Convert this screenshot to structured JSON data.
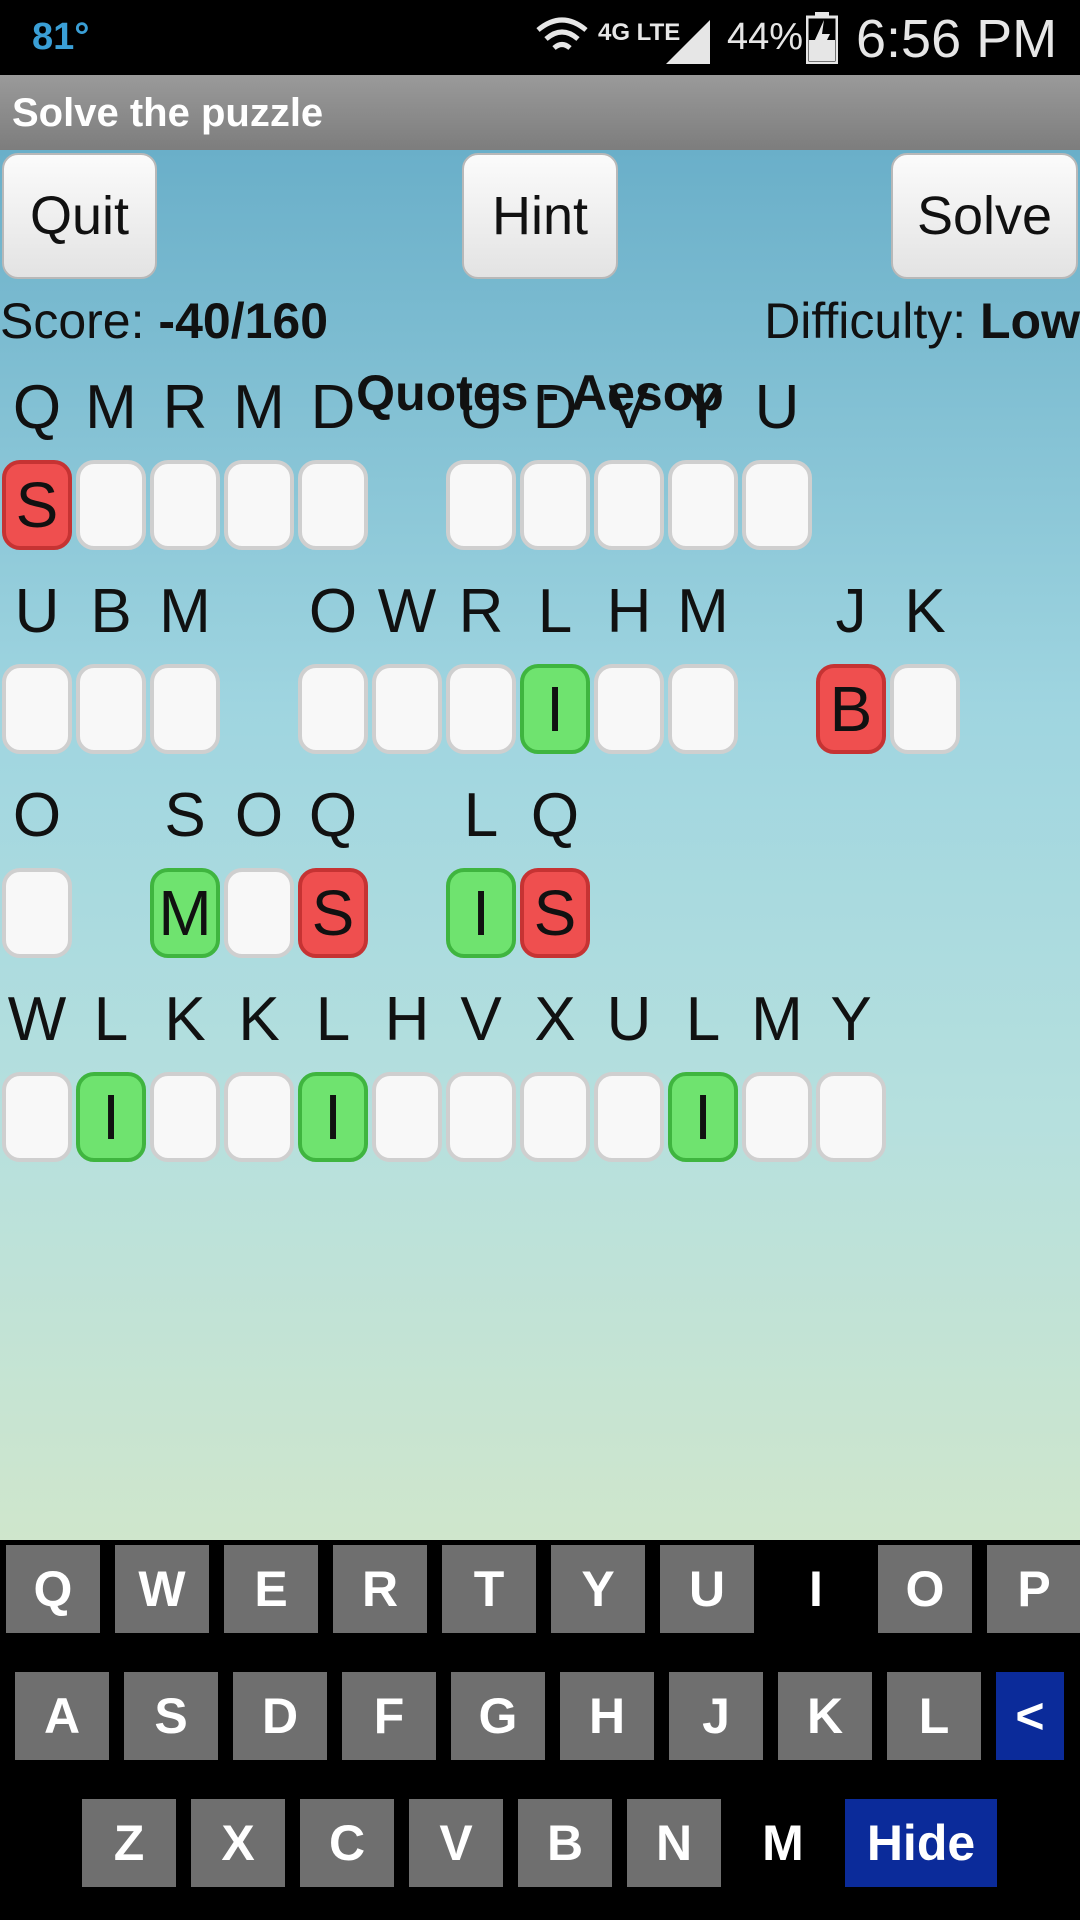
{
  "status_bar": {
    "temperature": "81°",
    "network": "4G LTE",
    "battery": "44%",
    "time": "6:56 PM"
  },
  "app": {
    "title": "Solve the puzzle"
  },
  "buttons": {
    "quit": "Quit",
    "hint": "Hint",
    "solve": "Solve"
  },
  "score": {
    "label": "Score:",
    "value": "-40/160"
  },
  "difficulty": {
    "label": "Difficulty:",
    "value": "Low"
  },
  "category": "Quotes - Aesop",
  "puzzle": {
    "colors": {
      "wrong": "#ef4f4f",
      "correct": "#6fe36f"
    },
    "lines": [
      {
        "cipher": [
          "Q",
          "M",
          "R",
          "M",
          "D",
          "",
          "U",
          "D",
          "V",
          "Y",
          "U"
        ],
        "answer": [
          "S",
          "",
          "",
          "",
          "",
          "",
          "",
          "",
          "",
          "",
          ""
        ],
        "state": [
          "wrong",
          "",
          "",
          "",
          "",
          "",
          "",
          "",
          "",
          "",
          ""
        ]
      },
      {
        "cipher": [
          "U",
          "B",
          "M",
          "",
          "O",
          "W",
          "R",
          "L",
          "H",
          "M",
          "",
          "J",
          "K"
        ],
        "answer": [
          "",
          "",
          "",
          "",
          "",
          "",
          "",
          "I",
          "",
          "",
          "",
          "B",
          ""
        ],
        "state": [
          "",
          "",
          "",
          "",
          "",
          "",
          "",
          "correct",
          "",
          "",
          "",
          "wrong",
          ""
        ]
      },
      {
        "cipher": [
          "O",
          "",
          "S",
          "O",
          "Q",
          "",
          "L",
          "Q"
        ],
        "answer": [
          "",
          "",
          "M",
          "",
          "S",
          "",
          "I",
          "S"
        ],
        "state": [
          "",
          "",
          "correct",
          "",
          "wrong",
          "",
          "correct",
          "wrong"
        ]
      },
      {
        "cipher": [
          "W",
          "L",
          "K",
          "K",
          "L",
          "H",
          "V",
          "X",
          "U",
          "L",
          "M",
          "Y"
        ],
        "answer": [
          "",
          "I",
          "",
          "",
          "I",
          "",
          "",
          "",
          "",
          "I",
          "",
          ""
        ],
        "state": [
          "",
          "correct",
          "",
          "",
          "correct",
          "",
          "",
          "",
          "",
          "correct",
          "",
          ""
        ]
      }
    ]
  },
  "keyboard": {
    "rows": [
      [
        "Q",
        "W",
        "E",
        "R",
        "T",
        "Y",
        "U",
        "I",
        "O",
        "P"
      ],
      [
        "A",
        "S",
        "D",
        "F",
        "G",
        "H",
        "J",
        "K",
        "L",
        "<"
      ],
      [
        "Z",
        "X",
        "C",
        "V",
        "B",
        "N",
        "M",
        "Hide"
      ]
    ],
    "used_keys": [
      "I",
      "M"
    ],
    "accent": "#0b2b9a"
  }
}
